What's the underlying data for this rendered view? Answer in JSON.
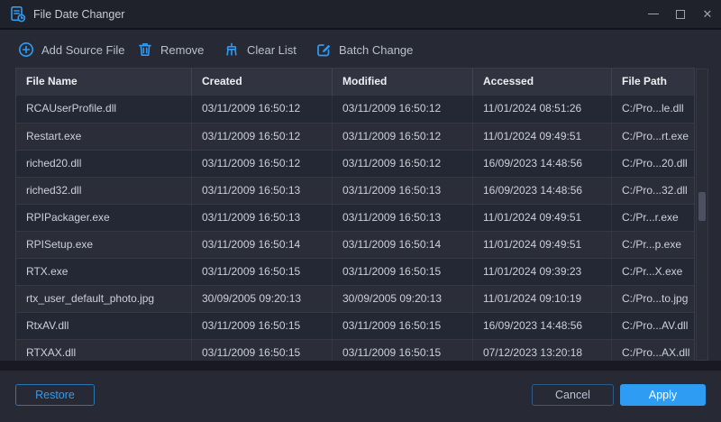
{
  "window": {
    "title": "File Date Changer",
    "close_glyph": "✕"
  },
  "toolbar": {
    "buttons": [
      {
        "id": "add-source-file",
        "label": "Add Source File"
      },
      {
        "id": "remove",
        "label": "Remove"
      },
      {
        "id": "clear-list",
        "label": "Clear List"
      },
      {
        "id": "batch-change",
        "label": "Batch Change"
      }
    ]
  },
  "table": {
    "columns": [
      "File Name",
      "Created",
      "Modified",
      "Accessed",
      "File Path"
    ],
    "column_keys": [
      "file-name",
      "created",
      "modified",
      "accessed",
      "file-path"
    ],
    "rows": [
      [
        "RCAUserProfile.dll",
        "03/11/2009 16:50:12",
        "03/11/2009 16:50:12",
        "11/01/2024 08:51:26",
        "C:/Pro...le.dll"
      ],
      [
        "Restart.exe",
        "03/11/2009 16:50:12",
        "03/11/2009 16:50:12",
        "11/01/2024 09:49:51",
        "C:/Pro...rt.exe"
      ],
      [
        "riched20.dll",
        "03/11/2009 16:50:12",
        "03/11/2009 16:50:12",
        "16/09/2023 14:48:56",
        "C:/Pro...20.dll"
      ],
      [
        "riched32.dll",
        "03/11/2009 16:50:13",
        "03/11/2009 16:50:13",
        "16/09/2023 14:48:56",
        "C:/Pro...32.dll"
      ],
      [
        "RPIPackager.exe",
        "03/11/2009 16:50:13",
        "03/11/2009 16:50:13",
        "11/01/2024 09:49:51",
        "C:/Pr...r.exe"
      ],
      [
        "RPISetup.exe",
        "03/11/2009 16:50:14",
        "03/11/2009 16:50:14",
        "11/01/2024 09:49:51",
        "C:/Pr...p.exe"
      ],
      [
        "RTX.exe",
        "03/11/2009 16:50:15",
        "03/11/2009 16:50:15",
        "11/01/2024 09:39:23",
        "C:/Pr...X.exe"
      ],
      [
        "rtx_user_default_photo.jpg",
        "30/09/2005 09:20:13",
        "30/09/2005 09:20:13",
        "11/01/2024 09:10:19",
        "C:/Pro...to.jpg"
      ],
      [
        "RtxAV.dll",
        "03/11/2009 16:50:15",
        "03/11/2009 16:50:15",
        "16/09/2023 14:48:56",
        "C:/Pro...AV.dll"
      ],
      [
        "RTXAX.dll",
        "03/11/2009 16:50:15",
        "03/11/2009 16:50:15",
        "07/12/2023 13:20:18",
        "C:/Pro...AX.dll"
      ]
    ]
  },
  "footer": {
    "restore_label": "Restore",
    "cancel_label": "Cancel",
    "apply_label": "Apply"
  },
  "colors": {
    "accent": "#2f9cf4",
    "titlebar_bg": "#1f212b",
    "content_bg": "#272935",
    "row_dark": "#242734",
    "row_light": "#2b2d39",
    "header_bg": "#313440"
  }
}
